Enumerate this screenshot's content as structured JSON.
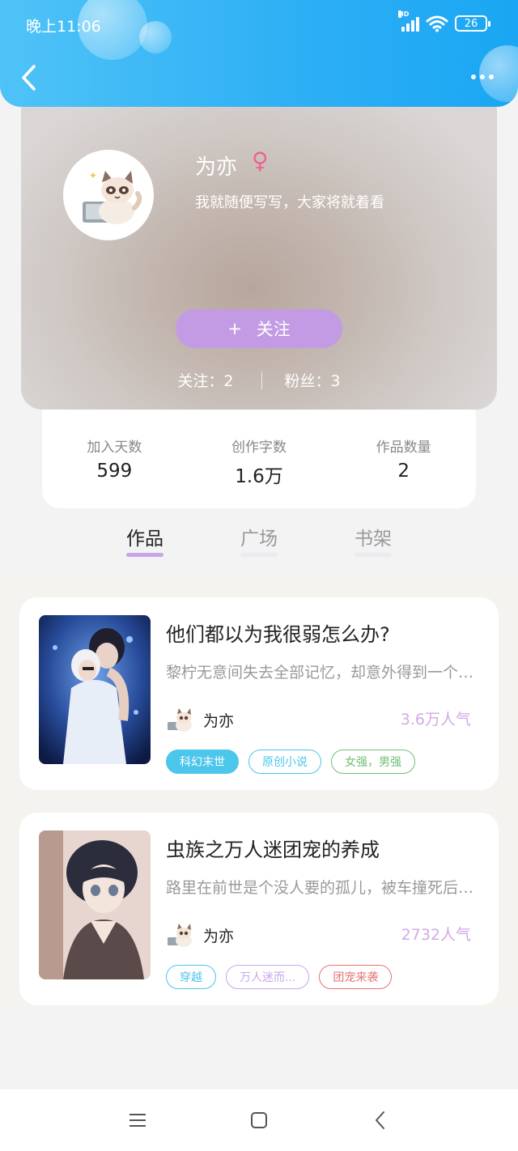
{
  "status_bar": {
    "time": "晚上11:06",
    "network": "HD",
    "battery": "26"
  },
  "header": {
    "back_icon": "chevron-left-icon",
    "more_icon": "more-dots-icon"
  },
  "profile": {
    "name": "为亦",
    "gender_symbol": "♀",
    "bio": "我就随便写写，大家将就着看",
    "follow_plus": "+",
    "follow_label": "关注",
    "following": "关注：2",
    "fans": "粉丝：3"
  },
  "stats": [
    {
      "label": "加入天数",
      "value": "599"
    },
    {
      "label": "创作字数",
      "value": "1.6万"
    },
    {
      "label": "作品数量",
      "value": "2"
    }
  ],
  "tabs": [
    {
      "label": "作品",
      "active": true
    },
    {
      "label": "广场",
      "active": false
    },
    {
      "label": "书架",
      "active": false
    }
  ],
  "works": [
    {
      "title": "他们都以为我很弱怎么办?",
      "description": "黎柠无意间失去全部记忆，却意外得到一个系统",
      "author": "为亦",
      "popularity": "3.6万人气",
      "tags": [
        {
          "label": "科幻末世",
          "color": "#4cc6ea",
          "filled": true
        },
        {
          "label": "原创小说",
          "color": "#4cc6ea",
          "filled": false
        },
        {
          "label": "女强，男强",
          "color": "#6fbf73",
          "filled": false
        }
      ]
    },
    {
      "title": "虫族之万人迷团宠的养成",
      "description": "路里在前世是个没人要的孤儿，被车撞死后穿越了",
      "author": "为亦",
      "popularity": "2732人气",
      "tags": [
        {
          "label": "穿越",
          "color": "#4cc6ea",
          "filled": false
        },
        {
          "label": "万人迷而...",
          "color": "#c9a6ea",
          "filled": false
        },
        {
          "label": "团宠来袭",
          "color": "#e57373",
          "filled": false
        }
      ]
    }
  ],
  "colors": {
    "header_blue": "#2fb0f5",
    "accent_purple": "#c39be4",
    "gender_pink": "#f06292",
    "popularity": "#d3a9e3"
  },
  "navbar": {
    "menu_icon": "menu-icon",
    "home_icon": "home-square-icon",
    "back_icon": "back-triangle-icon"
  }
}
